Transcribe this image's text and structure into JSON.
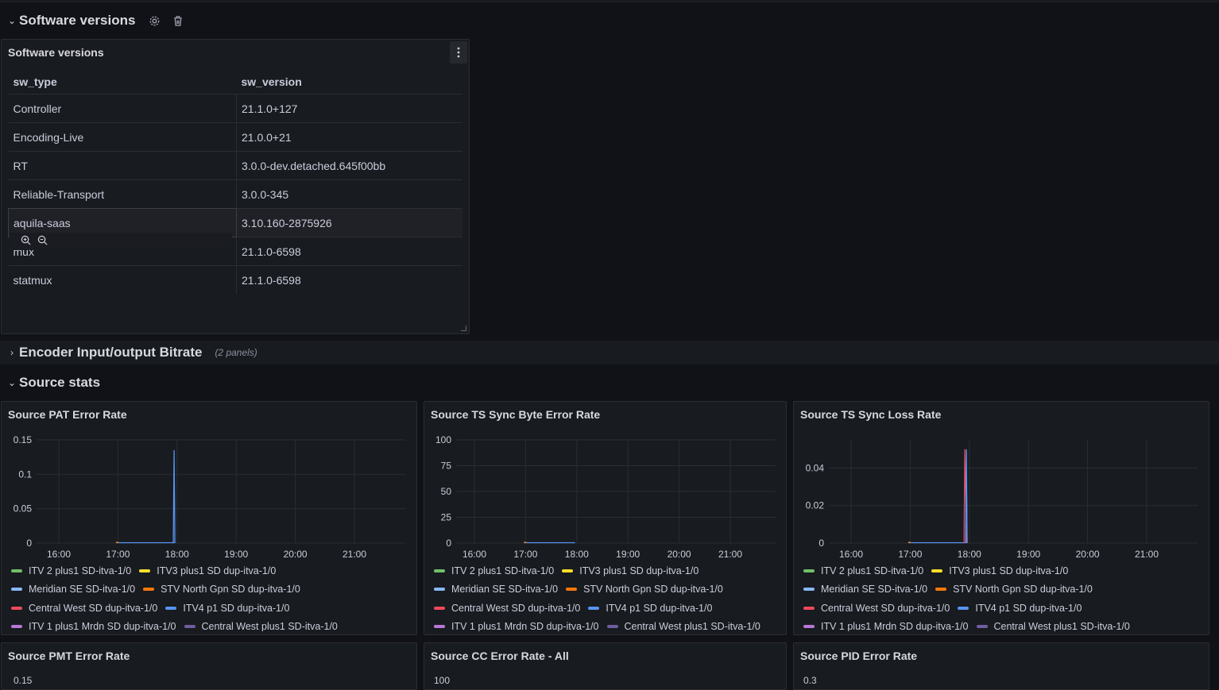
{
  "rows": {
    "software": {
      "title": "Software versions"
    },
    "encoder": {
      "title": "Encoder Input/output Bitrate",
      "note": "(2 panels)"
    },
    "source": {
      "title": "Source stats"
    }
  },
  "sw_panel": {
    "title": "Software versions",
    "columns": [
      "sw_type",
      "sw_version"
    ],
    "rows": [
      [
        "Controller",
        "21.1.0+127"
      ],
      [
        "Encoding-Live",
        "21.0.0+21"
      ],
      [
        "RT",
        "3.0.0-dev.detached.645f00bb"
      ],
      [
        "Reliable-Transport",
        "3.0.0-345"
      ],
      [
        "aquila-saas",
        "3.10.160-2875926"
      ],
      [
        "mux",
        "21.1.0-6598"
      ],
      [
        "statmux",
        "21.1.0-6598"
      ]
    ]
  },
  "legend_colors": [
    "#73bf69",
    "#fade2a",
    "#8ab8ff",
    "#ff780a",
    "#f2495c",
    "#5794f2",
    "#b877d9",
    "#705da0"
  ],
  "legend_items": [
    "ITV 2 plus1 SD-itva-1/0",
    "ITV3 plus1 SD dup-itva-1/0",
    "Meridian SE SD-itva-1/0",
    "STV North Gpn SD dup-itva-1/0",
    "Central West SD dup-itva-1/0",
    "ITV4 p1 SD dup-itva-1/0",
    "ITV 1 plus1 Mrdn SD dup-itva-1/0",
    "Central West plus1 SD-itva-1/0"
  ],
  "chart_data": [
    {
      "type": "line",
      "title": "Source PAT Error Rate",
      "x_ticks": [
        "16:00",
        "17:00",
        "18:00",
        "19:00",
        "20:00",
        "21:00"
      ],
      "y_ticks": [
        "0",
        "0.05",
        "0.1",
        "0.15"
      ],
      "ylim": [
        0,
        0.15
      ],
      "spike": {
        "time": "17:57",
        "value": 0.135
      },
      "grid": true,
      "legend": "bottom"
    },
    {
      "type": "line",
      "title": "Source TS Sync Byte Error Rate",
      "x_ticks": [
        "16:00",
        "17:00",
        "18:00",
        "19:00",
        "20:00",
        "21:00"
      ],
      "y_ticks": [
        "0",
        "25",
        "50",
        "75",
        "100"
      ],
      "ylim": [
        0,
        100
      ],
      "spike": null,
      "grid": true,
      "legend": "bottom"
    },
    {
      "type": "line",
      "title": "Source TS Sync Loss Rate",
      "x_ticks": [
        "16:00",
        "17:00",
        "18:00",
        "19:00",
        "20:00",
        "21:00"
      ],
      "y_ticks": [
        "0",
        "0.02",
        "0.04"
      ],
      "ylim": [
        0,
        0.055
      ],
      "spike": {
        "time": "17:57",
        "value": 0.05
      },
      "grid": true,
      "legend": "bottom"
    }
  ],
  "bottom_panels": [
    {
      "title": "Source PMT Error Rate",
      "first_tick": "0.15"
    },
    {
      "title": "Source CC Error Rate - All",
      "first_tick": "100"
    },
    {
      "title": "Source PID Error Rate",
      "first_tick": "0.3"
    }
  ]
}
